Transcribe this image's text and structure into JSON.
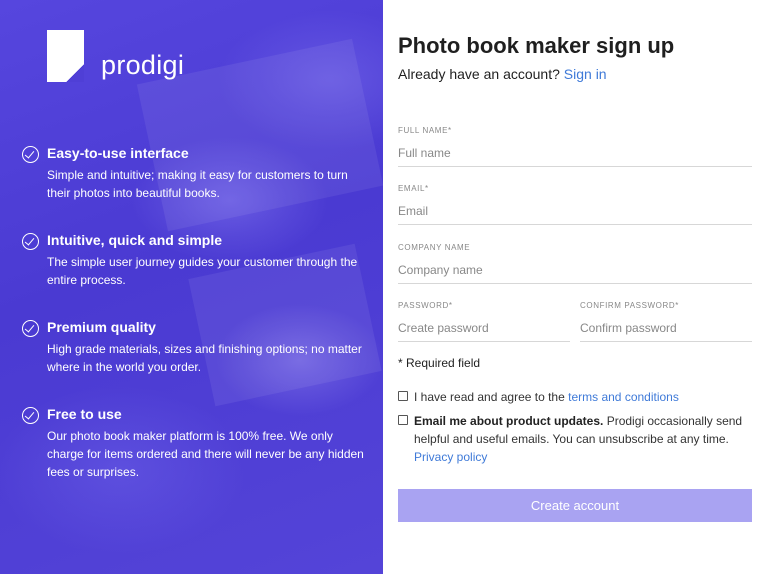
{
  "brand": {
    "name": "prodigi",
    "accent": "#4f3fd6"
  },
  "features": [
    {
      "title": "Easy-to-use interface",
      "text": "Simple and intuitive; making it easy for customers to turn their photos into beautiful books."
    },
    {
      "title": "Intuitive, quick and simple",
      "text": "The simple user journey guides your customer through the entire process."
    },
    {
      "title": "Premium quality",
      "text": "High grade materials, sizes and finishing options; no matter where in the world you order."
    },
    {
      "title": "Free to use",
      "text": "Our photo book maker platform is 100% free. We only charge for items ordered and there will never be any hidden fees or surprises."
    }
  ],
  "form": {
    "title": "Photo book maker sign up",
    "signin_prompt": "Already have an account?",
    "signin_link": "Sign in",
    "fields": {
      "full_name": {
        "label": "FULL NAME*",
        "placeholder": "Full name",
        "value": ""
      },
      "email": {
        "label": "EMAIL*",
        "placeholder": "Email",
        "value": ""
      },
      "company": {
        "label": "COMPANY NAME",
        "placeholder": "Company name",
        "value": ""
      },
      "password": {
        "label": "PASSWORD*",
        "placeholder": "Create password",
        "value": ""
      },
      "confirm_password": {
        "label": "CONFIRM PASSWORD*",
        "placeholder": "Confirm password",
        "value": ""
      }
    },
    "required_note": "* Required field",
    "terms": {
      "prefix": "I have read and agree to the ",
      "link": "terms and conditions"
    },
    "updates": {
      "bold": "Email me about product updates.",
      "text": " Prodigi occasionally send helpful and useful emails. You can unsubscribe at any time.",
      "link": "Privacy policy"
    },
    "submit_label": "Create account",
    "link_color": "#3f7ad8",
    "button_color": "#a9a3f2"
  }
}
